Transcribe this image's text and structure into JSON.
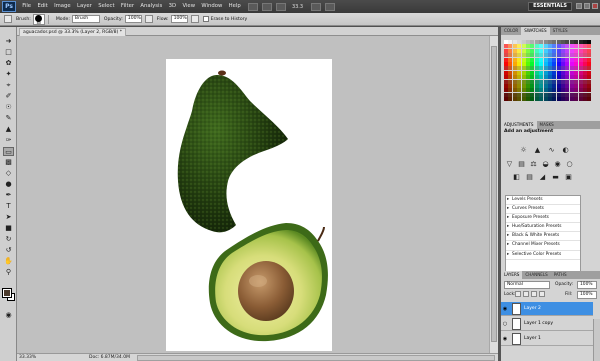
{
  "menubar": {
    "logo": "Ps",
    "items": [
      "File",
      "Edit",
      "Image",
      "Layer",
      "Select",
      "Filter",
      "Analysis",
      "3D",
      "View",
      "Window",
      "Help"
    ],
    "zoom": "33.3",
    "workspace": "ESSENTIALS"
  },
  "options": {
    "brush_label": "Brush:",
    "brush_size": "80",
    "mode_label": "Mode:",
    "mode_value": "Brush",
    "opacity_label": "Opacity:",
    "opacity_value": "100%",
    "flow_label": "Flow:",
    "flow_value": "100%",
    "erase_history_label": "Erase to History"
  },
  "document": {
    "tab_title": "aguacador.psd @ 33.3% (Layer 2, RGB/8) *",
    "status_zoom": "33.33%",
    "status_doc": "Doc: 6.87M/34.0M"
  },
  "swatches_panel": {
    "tabs": [
      "COLOR",
      "SWATCHES",
      "STYLES"
    ],
    "active_tab": "SWATCHES"
  },
  "adjustments_panel": {
    "tabs": [
      "ADJUSTMENTS",
      "MASKS"
    ],
    "title": "Add an adjustment",
    "presets": [
      "Levels Presets",
      "Curves Presets",
      "Exposure Presets",
      "Hue/Saturation Presets",
      "Black & White Presets",
      "Channel Mixer Presets",
      "Selective Color Presets"
    ]
  },
  "layers_panel": {
    "tabs": [
      "LAYERS",
      "CHANNELS",
      "PATHS"
    ],
    "blend_mode": "Normal",
    "opacity_label": "Opacity:",
    "opacity_value": "100%",
    "lock_label": "Lock:",
    "fill_label": "Fill:",
    "fill_value": "100%",
    "layers": [
      {
        "name": "Layer 2",
        "selected": true
      },
      {
        "name": "Layer 1 copy",
        "selected": false
      },
      {
        "name": "Layer 1",
        "selected": false
      }
    ]
  },
  "colors": {
    "foreground": "#4b3a2c",
    "background": "#ffffff",
    "selection_blue": "#3e8fe3",
    "canvas_gray": "#c0c0c0"
  }
}
